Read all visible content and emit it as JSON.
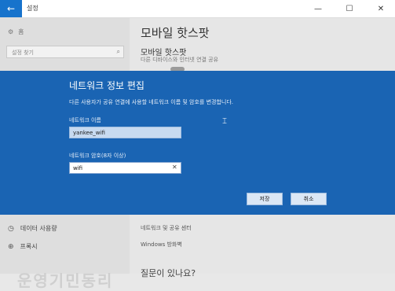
{
  "window": {
    "back_icon": "←",
    "title": "설정",
    "minimize": "—",
    "maximize": "☐",
    "close": "✕"
  },
  "sidebar": {
    "home_label": "홈",
    "search_placeholder": "설정 찾기",
    "items": [
      {
        "label": "데이터 사용량",
        "icon": "clock-icon"
      },
      {
        "label": "프록시",
        "icon": "globe-icon"
      }
    ],
    "watermark": "운영기민동리"
  },
  "main": {
    "page_title": "모바일 핫스팟",
    "section_title": "모바일 핫스팟",
    "section_desc": "다른 디바이스와 인터넷 연결 공유",
    "links": [
      "네트워크 및 공유 센터",
      "Windows 방화벽"
    ],
    "bottom_heading": "질문이 있나요?"
  },
  "dialog": {
    "title": "네트워크 정보 편집",
    "description": "다른 사용자가 공유 연결에 사용할 네트워크 이름 및 암호를 변경합니다.",
    "name_label": "네트워크 이름",
    "name_value": "yankee_wifi",
    "password_label": "네트워크 암호(8자 이상)",
    "password_value": "wifi",
    "save_label": "저장",
    "cancel_label": "취소"
  }
}
